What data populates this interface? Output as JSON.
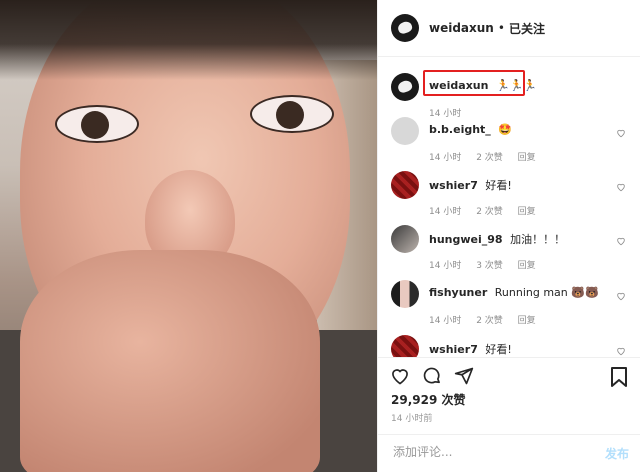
{
  "post": {
    "username": "weidaxun",
    "separator": "•",
    "follow_status": "已关注"
  },
  "caption": {
    "username": "weidaxun",
    "emoji": "🏃🏃🏃",
    "time": "14 小时"
  },
  "comments": [
    {
      "username": "b.b.eight_",
      "text": "🤩",
      "time": "14 小时",
      "likes": "2 次赞",
      "reply": "回复"
    },
    {
      "username": "wshier7",
      "text": "好看!",
      "time": "14 小时",
      "likes": "2 次赞",
      "reply": "回复"
    },
    {
      "username": "hungwei_98",
      "text": "加油！！！",
      "time": "14 小时",
      "likes": "3 次赞",
      "reply": "回复"
    },
    {
      "username": "fishyuner",
      "text": "Running man 🐻🐻",
      "time": "14 小时",
      "likes": "2 次赞",
      "reply": "回复"
    },
    {
      "username": "wshier7",
      "text": "好看!",
      "time": "",
      "likes": "",
      "reply": ""
    }
  ],
  "stats": {
    "likes": "29,929 次赞",
    "time": "14 小时前"
  },
  "composer": {
    "placeholder": "添加评论...",
    "post_label": "发布"
  },
  "colors": {
    "highlight": "#e32020",
    "post_disabled": "#b2dffc"
  },
  "icons": [
    "heart-icon",
    "comment-icon",
    "share-icon",
    "bookmark-icon"
  ]
}
